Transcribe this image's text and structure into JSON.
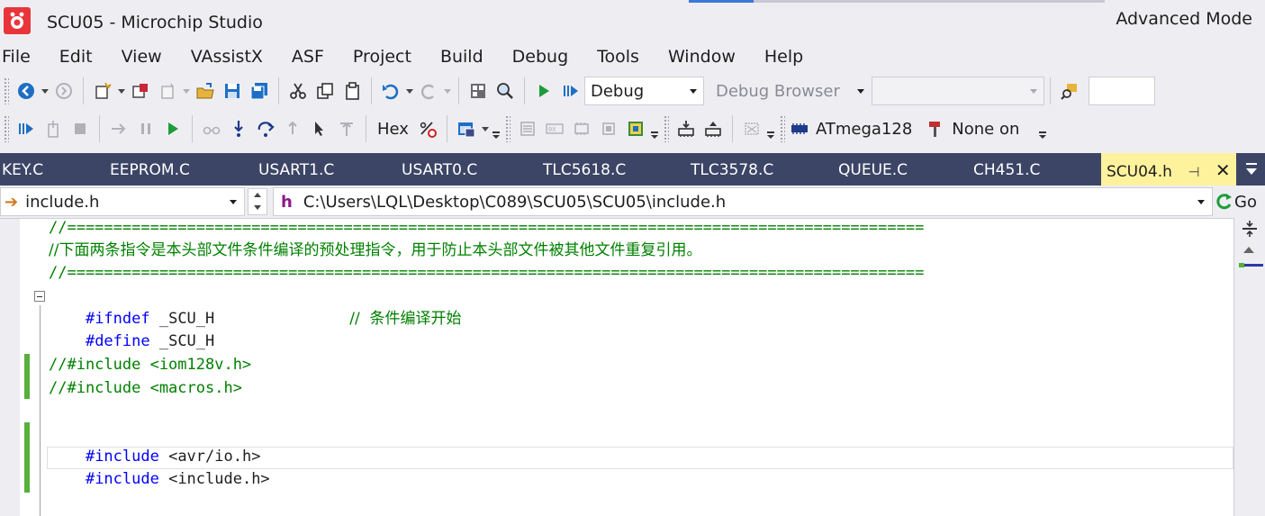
{
  "window": {
    "title": "SCU05 - Microchip Studio",
    "mode_label": "Advanced Mode"
  },
  "menu": [
    "File",
    "Edit",
    "View",
    "VAssistX",
    "ASF",
    "Project",
    "Build",
    "Debug",
    "Tools",
    "Window",
    "Help"
  ],
  "toolbar1": {
    "configuration": "Debug",
    "debug_browser": "Debug Browser",
    "platform": "",
    "search": ""
  },
  "toolbar2": {
    "hex_label": "Hex",
    "device_label": "ATmega128",
    "tool_label": "None on"
  },
  "tabs": [
    "KEY.C",
    "EEPROM.C",
    "USART1.C",
    "USART0.C",
    "TLC5618.C",
    "TLC3578.C",
    "QUEUE.C",
    "CH451.C"
  ],
  "active_tab": {
    "label": "SCU04.h",
    "pin_glyph": "⊣",
    "close_glyph": "✕"
  },
  "navbar": {
    "symbol_combo": "include.h",
    "path_prefix": "h",
    "path_combo": "C:\\Users\\LQL\\Desktop\\C089\\SCU05\\SCU05\\include.h",
    "go_label": "Go"
  },
  "code": {
    "line1": "//=============================================================================================",
    "line2": "//下面两条指令是本头部文件条件编译的预处理指令，用于防止本头部文件被其他文件重复引用。",
    "line3": "//=============================================================================================",
    "line4_kw": "#ifndef",
    "line4_id": " _SCU_H",
    "line4_cmt": "//  条件编译开始",
    "line5_kw": "#define",
    "line5_id": " _SCU_H",
    "line6": "//#include <iom128v.h>",
    "line7": "//#include <macros.h>",
    "line8_kw": "#include",
    "line8_id": " <avr/io.h>",
    "line9_kw": "#include",
    "line9_id": " <include.h>"
  },
  "colors": {
    "tab_strip": "#3c4566",
    "active_tab": "#fff29d",
    "comment": "#008000",
    "keyword": "#0000ff",
    "change_bar": "#57b03a"
  }
}
